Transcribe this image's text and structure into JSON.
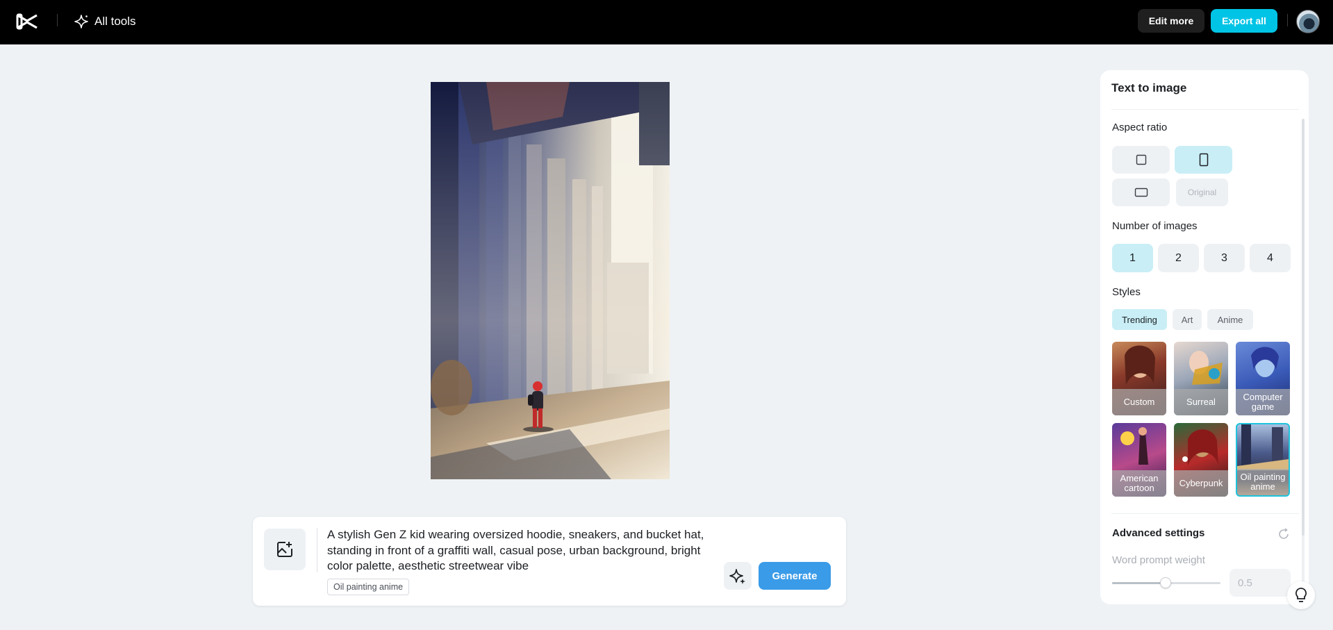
{
  "header": {
    "all_tools_label": "All tools",
    "edit_more_label": "Edit more",
    "export_all_label": "Export all"
  },
  "prompt": {
    "text": "A stylish Gen Z kid wearing oversized hoodie, sneakers, and bucket hat, standing in front of a graffiti wall, casual pose, urban background, bright color palette, aesthetic streetwear vibe",
    "style_chip": "Oil painting anime",
    "generate_label": "Generate"
  },
  "panel": {
    "title": "Text to image",
    "aspect_ratio_label": "Aspect ratio",
    "aspect_original_label": "Original",
    "aspect_selected": "portrait",
    "number_of_images_label": "Number of images",
    "numbers": [
      "1",
      "2",
      "3",
      "4"
    ],
    "number_selected": "1",
    "styles_label": "Styles",
    "style_tabs": [
      "Trending",
      "Art",
      "Anime"
    ],
    "style_tab_selected": "Trending",
    "styles": [
      {
        "label": "Custom"
      },
      {
        "label": "Surreal"
      },
      {
        "label": "Computer game"
      },
      {
        "label": "American cartoon"
      },
      {
        "label": "Cyberpunk"
      },
      {
        "label": "Oil painting anime"
      }
    ],
    "style_selected": "Oil painting anime",
    "advanced_label": "Advanced settings",
    "word_prompt_weight_label": "Word prompt weight",
    "word_prompt_weight_value": "0.5"
  },
  "colors": {
    "accent": "#00c4e6",
    "generate": "#3a9be8",
    "selected_bg": "#c9eef6",
    "page_bg": "#eef2f5"
  }
}
